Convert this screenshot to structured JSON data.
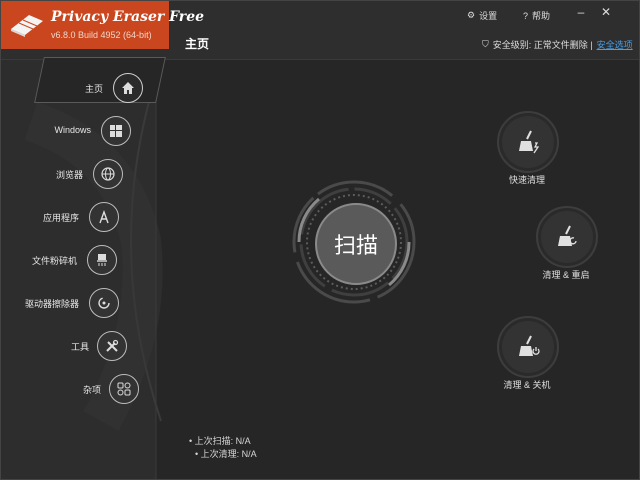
{
  "app": {
    "title": "Privacy Eraser Free",
    "version": "v6.8.0 Build 4952 (64-bit)"
  },
  "toolbar": {
    "settings_label": "设置",
    "help_label": "帮助",
    "minimize_icon": "minimize-icon",
    "close_icon": "close-icon"
  },
  "header": {
    "page_title": "主页",
    "security_text": "安全级别: 正常文件删除  |",
    "security_link": "安全选项"
  },
  "sidebar": {
    "items": [
      {
        "label": "主页",
        "icon": "home-icon"
      },
      {
        "label": "Windows",
        "icon": "windows-icon"
      },
      {
        "label": "浏览器",
        "icon": "globe-icon"
      },
      {
        "label": "应用程序",
        "icon": "apps-icon"
      },
      {
        "label": "文件粉碎机",
        "icon": "shredder-icon"
      },
      {
        "label": "驱动器擦除器",
        "icon": "drive-wiper-icon"
      },
      {
        "label": "工具",
        "icon": "tools-icon"
      },
      {
        "label": "杂项",
        "icon": "misc-icon"
      }
    ]
  },
  "main": {
    "scan_label": "扫描",
    "actions": [
      {
        "label": "快速清理",
        "icon": "broom-quick-icon"
      },
      {
        "label": "清理 & 重启",
        "icon": "broom-restart-icon"
      },
      {
        "label": "清理 & 关机",
        "icon": "broom-shutdown-icon"
      }
    ],
    "last_scan": "上次扫描:  N/A",
    "last_clean": "上次清理:  N/A"
  },
  "colors": {
    "brand": "#c9461e",
    "background": "#2b2b2b",
    "link": "#4a9de0"
  }
}
